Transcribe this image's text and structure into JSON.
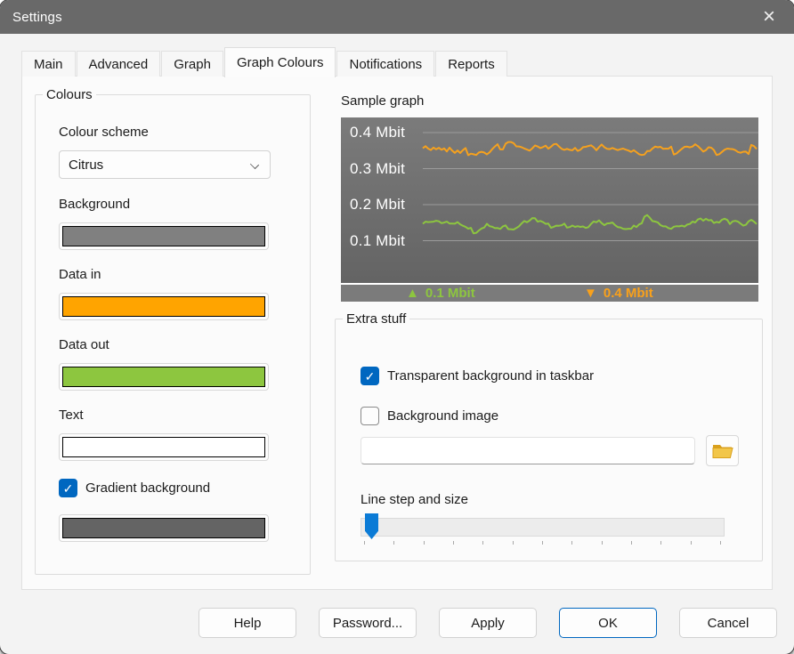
{
  "window": {
    "title": "Settings"
  },
  "icons": {
    "close": "×",
    "check": "✓",
    "folder": "folder-yellow"
  },
  "tabs": {
    "items": [
      "Main",
      "Advanced",
      "Graph",
      "Graph Colours",
      "Notifications",
      "Reports"
    ],
    "active": "Graph Colours"
  },
  "colours": {
    "group_title": "Colours",
    "scheme_label": "Colour scheme",
    "scheme_value": "Citrus",
    "background_label": "Background",
    "background_color": "#808080",
    "data_in_label": "Data in",
    "data_in_color": "#FFA400",
    "data_out_label": "Data out",
    "data_out_color": "#8DC63F",
    "text_label": "Text",
    "text_color": "#FFFFFF",
    "gradient_label": "Gradient background",
    "gradient_checked": true,
    "gradient_color": "#646464"
  },
  "sample": {
    "title": "Sample graph",
    "chart_data": {
      "type": "line",
      "title": "Sample graph",
      "y_tick_labels": [
        "0.4 Mbit",
        "0.3 Mbit",
        "0.2 Mbit",
        "0.1 Mbit"
      ],
      "y_ticks": [
        0.4,
        0.3,
        0.2,
        0.1
      ],
      "ylim": [
        0,
        0.44
      ],
      "grid": true,
      "series": [
        {
          "name": "data-in",
          "color": "#F5A11E",
          "approx_level": 0.355,
          "amplitude": 0.028
        },
        {
          "name": "data-out",
          "color": "#8DC63F",
          "approx_level": 0.152,
          "amplitude": 0.034
        }
      ],
      "legend": [
        {
          "icon": "▲",
          "label": "0.1 Mbit",
          "color": "#8DC63F"
        },
        {
          "icon": "▼",
          "label": "0.4 Mbit",
          "color": "#F9A11B"
        }
      ],
      "legend_position": "bottom"
    }
  },
  "extra": {
    "group_title": "Extra stuff",
    "transparent_label": "Transparent background in taskbar",
    "transparent_checked": true,
    "background_image_label": "Background image",
    "background_image_checked": false,
    "path_value": "",
    "slider_label": "Line step and size",
    "slider_value_percent": 0
  },
  "footer": {
    "help": "Help",
    "password": "Password...",
    "apply": "Apply",
    "ok": "OK",
    "cancel": "Cancel"
  }
}
